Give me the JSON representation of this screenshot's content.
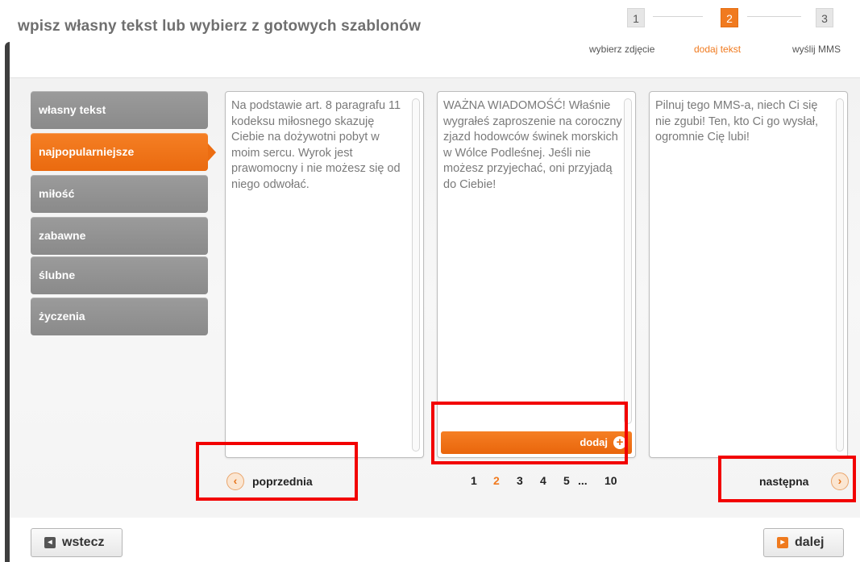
{
  "header": {
    "title": "wpisz własny tekst lub wybierz z gotowych szablonów"
  },
  "steps": [
    {
      "number": "1",
      "label": "wybierz zdjęcie",
      "active": false
    },
    {
      "number": "2",
      "label": "dodaj tekst",
      "active": true
    },
    {
      "number": "3",
      "label": "wyślij MMS",
      "active": false
    }
  ],
  "categories": [
    {
      "label": "własny tekst",
      "active": false
    },
    {
      "label": "najpopularniejsze",
      "active": true
    },
    {
      "label": "miłość",
      "active": false
    },
    {
      "label": "zabawne",
      "active": false
    },
    {
      "label": "ślubne",
      "active": false
    },
    {
      "label": "życzenia",
      "active": false
    }
  ],
  "templates": [
    {
      "text": "Na podstawie art. 8 paragrafu 11 kodeksu miłosnego skazuję Ciebie na dożywotni pobyt w moim sercu. Wyrok jest prawomocny i nie możesz się od niego odwołać."
    },
    {
      "text": "WAŻNA WIADOMOŚĆ! Właśnie wygrałeś zaproszenie na coroczny zjazd hodowców świnek morskich w Wólce Podleśnej. Jeśli nie możesz przyjechać, oni przyjadą do Ciebie!",
      "add_label": "dodaj"
    },
    {
      "text": "Pilnuj tego MMS-a, niech Ci się nie zgubi! Ten, kto Ci go wysłał, ogromnie Cię lubi!"
    }
  ],
  "navigation": {
    "prev_label": "poprzednia",
    "next_label": "następna",
    "pages": [
      "1",
      "2",
      "3",
      "4",
      "5",
      "...",
      "10"
    ],
    "current_page": "2"
  },
  "footer": {
    "back_label": "wstecz",
    "next_label": "dalej"
  },
  "colors": {
    "accent": "#f07a1f",
    "highlight": "#f20000",
    "category_gray": "#939393"
  }
}
